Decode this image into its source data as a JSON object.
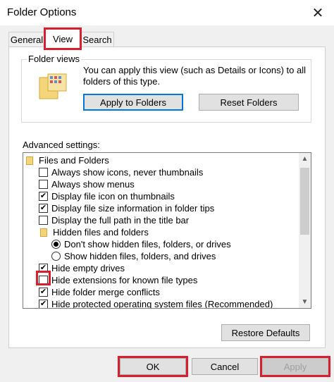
{
  "window": {
    "title": "Folder Options",
    "close_glyph": "✕"
  },
  "tabs": [
    {
      "label": "General",
      "active": false
    },
    {
      "label": "View",
      "active": true
    },
    {
      "label": "Search",
      "active": false
    }
  ],
  "folder_views": {
    "group_label": "Folder views",
    "description": "You can apply this view (such as Details or Icons) to all folders of this type.",
    "apply_button": "Apply to Folders",
    "reset_button": "Reset Folders"
  },
  "advanced": {
    "label": "Advanced settings:",
    "items": [
      {
        "type": "folder",
        "label": "Files and Folders",
        "level": 0
      },
      {
        "type": "checkbox",
        "label": "Always show icons, never thumbnails",
        "checked": false,
        "level": 1
      },
      {
        "type": "checkbox",
        "label": "Always show menus",
        "checked": false,
        "level": 1
      },
      {
        "type": "checkbox",
        "label": "Display file icon on thumbnails",
        "checked": true,
        "level": 1
      },
      {
        "type": "checkbox",
        "label": "Display file size information in folder tips",
        "checked": true,
        "level": 1
      },
      {
        "type": "checkbox",
        "label": "Display the full path in the title bar",
        "checked": false,
        "level": 1
      },
      {
        "type": "folder",
        "label": "Hidden files and folders",
        "level": 1
      },
      {
        "type": "radio",
        "label": "Don't show hidden files, folders, or drives",
        "checked": true,
        "level": 2
      },
      {
        "type": "radio",
        "label": "Show hidden files, folders, and drives",
        "checked": false,
        "level": 2
      },
      {
        "type": "checkbox",
        "label": "Hide empty drives",
        "checked": true,
        "level": 1
      },
      {
        "type": "checkbox",
        "label": "Hide extensions for known file types",
        "checked": false,
        "level": 1
      },
      {
        "type": "checkbox",
        "label": "Hide folder merge conflicts",
        "checked": true,
        "level": 1
      },
      {
        "type": "checkbox",
        "label": "Hide protected operating system files (Recommended)",
        "checked": true,
        "level": 1
      }
    ]
  },
  "restore_defaults_button": "Restore Defaults",
  "footer": {
    "ok_label": "OK",
    "cancel_label": "Cancel",
    "apply_label": "Apply"
  },
  "colors": {
    "highlight_red": "#d62030",
    "focus_blue": "#0078d7",
    "folder_yellow": "#f5d57a"
  }
}
